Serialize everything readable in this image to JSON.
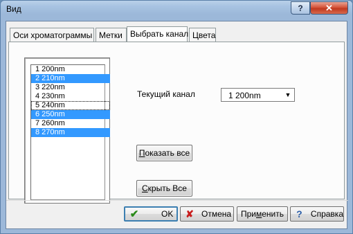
{
  "window": {
    "title": "Вид",
    "help_glyph": "?",
    "close_glyph": "✕"
  },
  "tabs": [
    {
      "label": "Оси хроматограммы",
      "active": false
    },
    {
      "label": "Метки",
      "active": false
    },
    {
      "label": "Выбрать канал",
      "active": true
    },
    {
      "label": "Цвета",
      "active": false
    }
  ],
  "channel_list": {
    "items": [
      {
        "label": "1 200nm",
        "selected": false,
        "focused": false
      },
      {
        "label": "2 210nm",
        "selected": true,
        "focused": false
      },
      {
        "label": "3 220nm",
        "selected": false,
        "focused": false
      },
      {
        "label": "4 230nm",
        "selected": false,
        "focused": false
      },
      {
        "label": "5 240nm",
        "selected": false,
        "focused": true
      },
      {
        "label": "6 250nm",
        "selected": true,
        "focused": false
      },
      {
        "label": "7 260nm",
        "selected": false,
        "focused": false
      },
      {
        "label": "8 270nm",
        "selected": true,
        "focused": false
      }
    ]
  },
  "current_channel": {
    "label": "Текущий канал",
    "value": "1 200nm"
  },
  "buttons": {
    "show_all_mnemonic": "П",
    "show_all_rest": "оказать все",
    "hide_all_mnemonic": "С",
    "hide_all_rest": "крыть Все"
  },
  "dialog_buttons": {
    "ok": "OK",
    "cancel": "Отмена",
    "apply_pre": "При",
    "apply_mnemonic": "м",
    "apply_post": "енить",
    "help": "Справка"
  },
  "colors": {
    "selection": "#3399ff",
    "ok_icon": "#2b8a1a",
    "cancel_icon": "#c81d1d",
    "help_icon": "#2b5ea8"
  }
}
